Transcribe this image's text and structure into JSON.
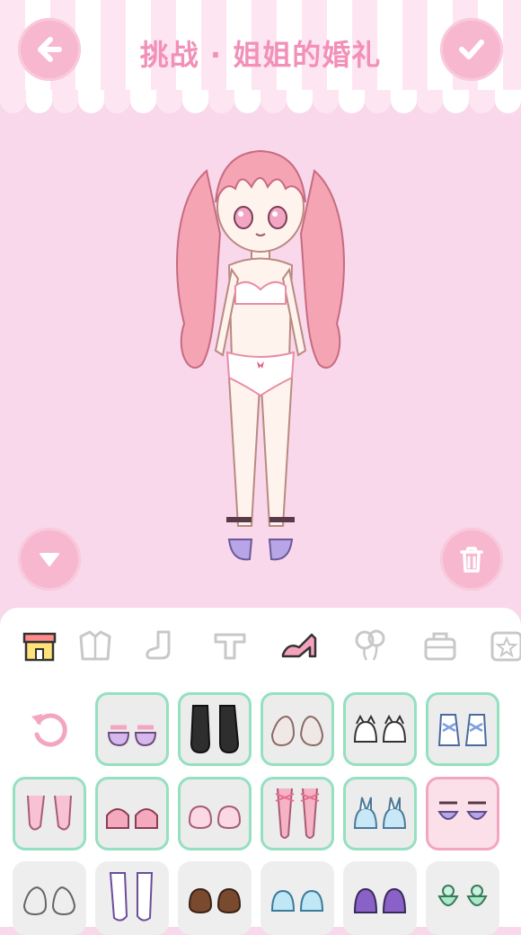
{
  "header": {
    "title": "挑战 · 姐姐的婚礼",
    "back_icon": "arrow-left-icon",
    "confirm_icon": "checkmark-icon"
  },
  "stage": {
    "collapse_icon": "triangle-down-icon",
    "delete_icon": "trash-icon"
  },
  "colors": {
    "background": "#f8d8ea",
    "accent": "#f7b7cf",
    "title": "#f290b8",
    "item_border": "#94e0c0",
    "selected_border": "#f3a6c2"
  },
  "categories": [
    {
      "icon": "shop-icon",
      "selected": false
    },
    {
      "icon": "jacket-icon",
      "selected": false
    },
    {
      "icon": "sock-icon",
      "selected": false
    },
    {
      "icon": "shirt-icon",
      "selected": false
    },
    {
      "icon": "high-heel-icon",
      "selected": true
    },
    {
      "icon": "balloons-icon",
      "selected": false
    },
    {
      "icon": "bag-icon",
      "selected": false
    },
    {
      "icon": "star-box-icon",
      "selected": false
    }
  ],
  "shoes": [
    {
      "name": "reset",
      "icon": "reset-icon"
    },
    {
      "name": "purple-bow-shoes",
      "owned": true
    },
    {
      "name": "black-boots",
      "owned": true
    },
    {
      "name": "gray-sneakers",
      "owned": true
    },
    {
      "name": "cat-slippers",
      "owned": true
    },
    {
      "name": "blue-sneakers",
      "owned": true
    },
    {
      "name": "pink-ballet-flats",
      "owned": true
    },
    {
      "name": "pink-frill-shoes",
      "owned": true
    },
    {
      "name": "pink-mary-janes",
      "owned": true
    },
    {
      "name": "pink-ribbon-pointe",
      "owned": true
    },
    {
      "name": "bunny-slippers",
      "owned": true
    },
    {
      "name": "lavender-pumps",
      "owned": true,
      "selected": true
    },
    {
      "name": "gray-high-tops",
      "owned": false
    },
    {
      "name": "lace-up-boots",
      "owned": false
    },
    {
      "name": "brown-loafers",
      "owned": false
    },
    {
      "name": "blue-bow-shoes",
      "owned": false
    },
    {
      "name": "purple-bunny-boots",
      "owned": false
    },
    {
      "name": "mint-pompom-shoes",
      "owned": false
    }
  ]
}
